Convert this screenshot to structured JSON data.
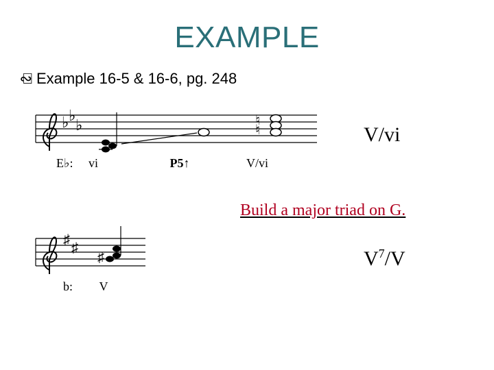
{
  "title": "EXAMPLE",
  "bullet": "Example 16-5 & 16-6, pg. 248",
  "figure1": {
    "key_label": "E♭:",
    "chord1": "vi",
    "interval": "P5↑",
    "chord2": "V/vi"
  },
  "annotation1": "V/vi",
  "caption": "Build a major triad on G.",
  "figure2": {
    "key_label": "b:",
    "chord1": "V"
  },
  "annotation2_prefix": "V",
  "annotation2_sup": "7",
  "annotation2_suffix": "/V"
}
